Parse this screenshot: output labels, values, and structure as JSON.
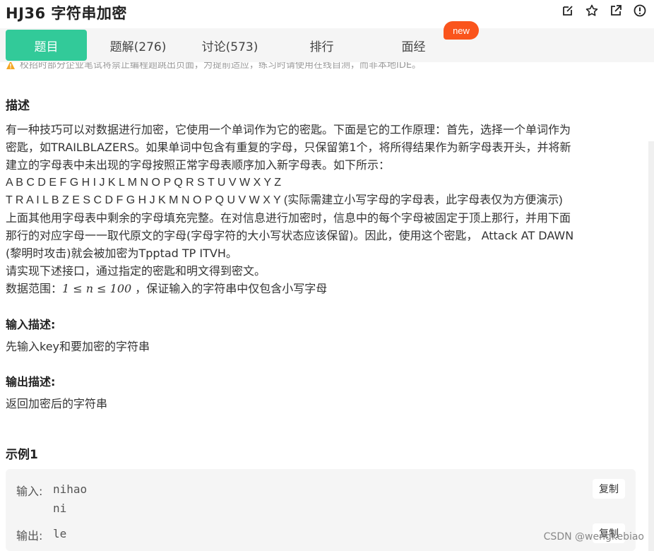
{
  "header": {
    "title": "HJ36  字符串加密",
    "icons": [
      "edit-icon",
      "star-icon",
      "external-link-icon",
      "info-icon"
    ]
  },
  "tabs": [
    {
      "label": "题目",
      "active": true
    },
    {
      "label": "题解(276)",
      "active": false
    },
    {
      "label": "讨论(573)",
      "active": false
    },
    {
      "label": "排行",
      "active": false
    },
    {
      "label": "面经",
      "active": false
    }
  ],
  "new_badge": "new",
  "warning": "校招时部分企业笔试将禁止编程题跳出页面，为提前适应，练习时请使用在线自测，而非本地IDE。",
  "description": {
    "heading": "描述",
    "lines": [
      "有一种技巧可以对数据进行加密，它使用一个单词作为它的密匙。下面是它的工作原理：首先，选择一个单词作为",
      "密匙，如TRAILBLAZERS。如果单词中包含有重复的字母，只保留第1个，将所得结果作为新字母表开头，并将新",
      "建立的字母表中未出现的字母按照正常字母表顺序加入新字母表。如下所示：",
      "A B C D E F G H I J K L M N O P Q R S T U V W X Y Z",
      "T R A I L B Z E S C D F G H J K M N O P Q U V W X Y (实际需建立小写字母的字母表，此字母表仅为方便演示)",
      "上面其他用字母表中剩余的字母填充完整。在对信息进行加密时，信息中的每个字母被固定于顶上那行，并用下面",
      "那行的对应字母一一取代原文的字母(字母字符的大小写状态应该保留)。因此，使用这个密匙， Attack AT DAWN",
      "(黎明时攻击)就会被加密为Tpptad TP ITVH。",
      "请实现下述接口，通过指定的密匙和明文得到密文。"
    ],
    "range_prefix": "数据范围：",
    "range_math": "1 ≤ n ≤ 100",
    "range_suffix": " ，保证输入的字符串中仅包含小写字母"
  },
  "input_desc": {
    "heading": "输入描述:",
    "text": "先输入key和要加密的字符串"
  },
  "output_desc": {
    "heading": "输出描述:",
    "text": "返回加密后的字符串"
  },
  "example": {
    "heading": "示例1",
    "input_label": "输入:",
    "input_lines": [
      "nihao",
      "ni"
    ],
    "output_label": "输出:",
    "output_value": "le",
    "copy_label": "复制"
  },
  "watermark": "CSDN @wengkebiao",
  "colors": {
    "accent": "#32ca99",
    "badge": "#fa541c",
    "warn_icon": "#f5a623"
  }
}
